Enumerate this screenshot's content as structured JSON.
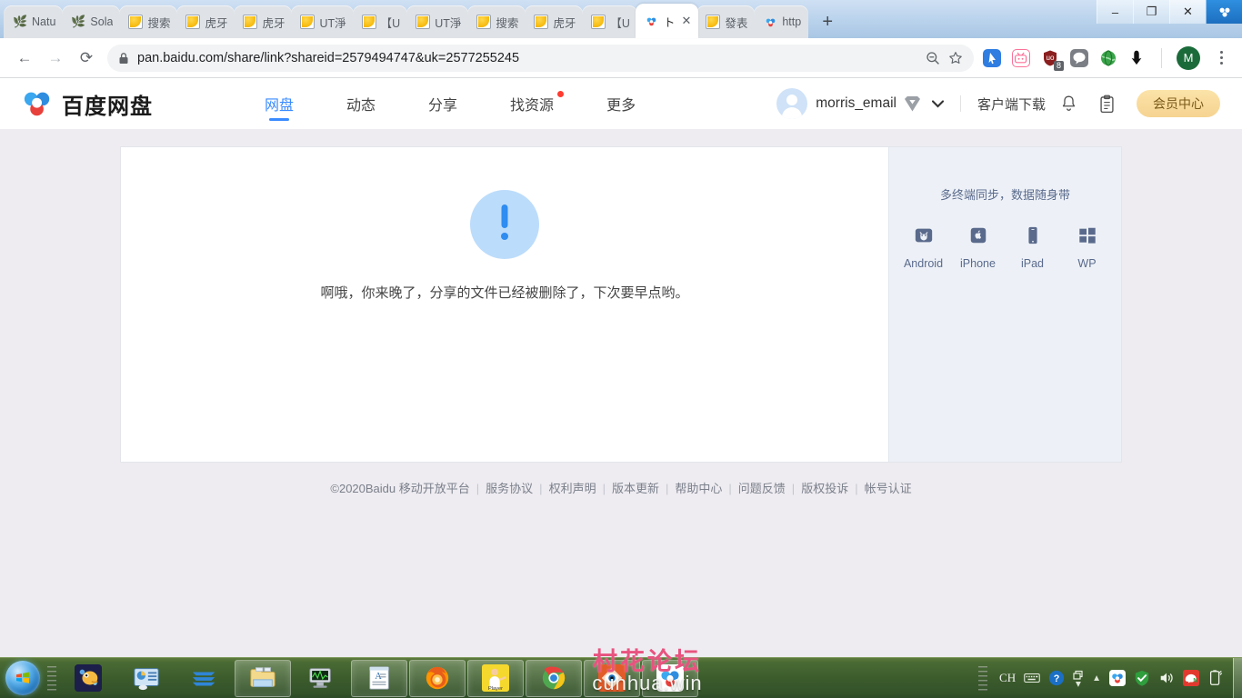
{
  "browser": {
    "tabs": [
      {
        "label": "Natu",
        "icon": "plant-icon",
        "active": false
      },
      {
        "label": "Sola",
        "icon": "plant-icon",
        "active": false
      },
      {
        "label": "搜索",
        "icon": "yellow-image-icon",
        "active": false
      },
      {
        "label": "虎牙",
        "icon": "yellow-image-icon",
        "active": false
      },
      {
        "label": "虎牙",
        "icon": "yellow-image-icon",
        "active": false
      },
      {
        "label": "UT淨",
        "icon": "yellow-image-icon",
        "active": false
      },
      {
        "label": "【U",
        "icon": "yellow-image-icon",
        "active": false
      },
      {
        "label": "UT淨",
        "icon": "yellow-image-icon",
        "active": false
      },
      {
        "label": "搜索",
        "icon": "yellow-image-icon",
        "active": false
      },
      {
        "label": "虎牙",
        "icon": "yellow-image-icon",
        "active": false
      },
      {
        "label": "【U",
        "icon": "yellow-image-icon",
        "active": false
      },
      {
        "label": "ト",
        "icon": "baidu-pan-icon",
        "active": true
      },
      {
        "label": "發表",
        "icon": "yellow-image-icon",
        "active": false
      },
      {
        "label": "http",
        "icon": "baidu-pan-icon",
        "active": false
      }
    ],
    "new_tab_label": "+",
    "close_tab_label": "✕",
    "window_controls": {
      "minimize": "–",
      "maximize": "❐",
      "close": "✕"
    },
    "nav": {
      "back": "←",
      "forward": "→",
      "reload": "⟳"
    },
    "url": "pan.baidu.com/share/link?shareid=2579494747&uk=2577255245",
    "lock_icon": "lock-icon",
    "zoom_out_icon": "zoom-out-icon",
    "bookmark_icon": "star-icon",
    "extensions": [
      {
        "name": "cursor-extension-icon",
        "color": "#2f7de1"
      },
      {
        "name": "bilibili-extension-icon",
        "color": "#fb7299"
      },
      {
        "name": "ublock-extension-icon",
        "color": "#8b1f1f",
        "badge": "8"
      },
      {
        "name": "line-extension-icon",
        "color": "#7b7f85"
      },
      {
        "name": "globe-extension-icon",
        "color": "#3aa34a"
      },
      {
        "name": "download-extension-icon",
        "color": "#111111"
      }
    ],
    "profile_initial": "M",
    "menu_icon": "kebab-menu-icon"
  },
  "site": {
    "logo_text": "百度网盘",
    "nav_items": [
      {
        "label": "网盘",
        "active": true,
        "dot": false
      },
      {
        "label": "动态",
        "active": false,
        "dot": false
      },
      {
        "label": "分享",
        "active": false,
        "dot": false
      },
      {
        "label": "找资源",
        "active": false,
        "dot": true
      },
      {
        "label": "更多",
        "active": false,
        "dot": false
      }
    ],
    "user": {
      "name": "morris_email",
      "vip_badge": "vip-badge-icon",
      "caret": "❯"
    },
    "client_download_label": "客户端下载",
    "bell_icon": "bell-icon",
    "clipboard_icon": "clipboard-icon",
    "vip_center_label": "会员中心"
  },
  "main": {
    "error_icon": "exclamation-circle-icon",
    "error_message": "啊哦，你来晚了，分享的文件已经被删除了，下次要早点哟。"
  },
  "sidebar": {
    "title": "多终端同步，数据随身带",
    "platforms": [
      {
        "label": "Android",
        "icon": "android-icon"
      },
      {
        "label": "iPhone",
        "icon": "iphone-icon"
      },
      {
        "label": "iPad",
        "icon": "ipad-icon"
      },
      {
        "label": "WP",
        "icon": "windows-phone-icon"
      }
    ]
  },
  "footer": {
    "copyright": "©2020Baidu 移动开放平台",
    "links": [
      "服务协议",
      "权利声明",
      "版本更新",
      "帮助中心",
      "问题反馈",
      "版权投诉",
      "帐号认证"
    ],
    "separator": "|"
  },
  "taskbar": {
    "start_label": "start-orb",
    "items": [
      {
        "name": "taskbar-item-spore",
        "icon": "spore-icon",
        "open": false
      },
      {
        "name": "taskbar-item-dashboard",
        "icon": "dashboard-icon",
        "open": false
      },
      {
        "name": "taskbar-item-editplus",
        "icon": "waves-icon",
        "open": false
      },
      {
        "name": "taskbar-item-explorer",
        "icon": "folder-icon",
        "open": true
      },
      {
        "name": "taskbar-item-monitor",
        "icon": "monitor-icon",
        "open": false
      },
      {
        "name": "taskbar-item-wordpad",
        "icon": "document-icon",
        "open": true
      },
      {
        "name": "taskbar-item-firefox",
        "icon": "firefox-icon",
        "open": true
      },
      {
        "name": "taskbar-item-player",
        "icon": "player-icon",
        "open": true
      },
      {
        "name": "taskbar-item-chrome",
        "icon": "chrome-icon",
        "open": true
      },
      {
        "name": "taskbar-item-faststone",
        "icon": "eye-icon",
        "open": true
      },
      {
        "name": "taskbar-item-baidupan",
        "icon": "baidu-pan-icon",
        "open": true
      }
    ],
    "tray": {
      "language": "CH",
      "keyboard_icon": "keyboard-icon",
      "help_icon": "help-icon",
      "window_icon": "window-icon",
      "overflow_icon": "chevron-up-icon",
      "items": [
        {
          "name": "tray-baidu-pan-icon"
        },
        {
          "name": "tray-shield-green-icon"
        },
        {
          "name": "tray-volume-icon"
        },
        {
          "name": "tray-youdao-icon"
        },
        {
          "name": "tray-battery-icon"
        }
      ]
    }
  },
  "watermark": {
    "top": "村花论坛",
    "bottom": "cunhua.win"
  }
}
